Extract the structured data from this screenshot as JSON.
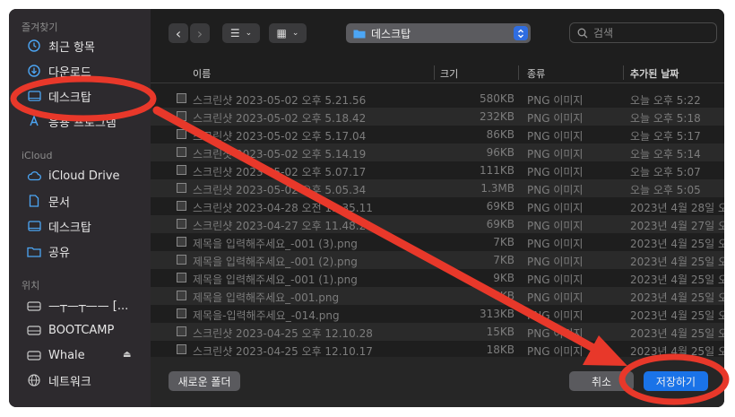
{
  "sidebar": {
    "favorites_title": "즐겨찾기",
    "favorites": [
      {
        "label": "최근 항목",
        "icon": "clock-icon"
      },
      {
        "label": "다운로드",
        "icon": "download-icon"
      },
      {
        "label": "데스크탑",
        "icon": "desktop-icon"
      },
      {
        "label": "응용 프로그램",
        "icon": "apps-icon"
      }
    ],
    "icloud_title": "iCloud",
    "icloud": [
      {
        "label": "iCloud Drive",
        "icon": "cloud-icon"
      },
      {
        "label": "문서",
        "icon": "document-icon"
      },
      {
        "label": "데스크탑",
        "icon": "desktop-icon"
      },
      {
        "label": "공유",
        "icon": "shared-folder-icon"
      }
    ],
    "locations_title": "위치",
    "locations": [
      {
        "label": "—┬—┬—— [...",
        "icon": "drive-icon"
      },
      {
        "label": "BOOTCAMP",
        "icon": "drive-icon"
      },
      {
        "label": "Whale",
        "icon": "drive-icon",
        "eject": "⏏"
      },
      {
        "label": "네트워크",
        "icon": "globe-icon"
      }
    ]
  },
  "toolbar": {
    "back": "‹",
    "forward": "›",
    "list_view": "☰",
    "grid_view": "▦",
    "location": "데스크탑",
    "search_placeholder": "검색"
  },
  "table": {
    "headers": {
      "name": "이름",
      "size": "크기",
      "kind": "종류",
      "date": "추가된 날짜"
    },
    "rows": [
      {
        "name": "스크린샷 2023-05-02 오후 5.21.56",
        "size": "580KB",
        "kind": "PNG 이미지",
        "date": "오늘 오후 5:22"
      },
      {
        "name": "스크린샷 2023-05-02 오후 5.18.42",
        "size": "232KB",
        "kind": "PNG 이미지",
        "date": "오늘 오후 5:18"
      },
      {
        "name": "스크린샷 2023-05-02 오후 5.17.04",
        "size": "86KB",
        "kind": "PNG 이미지",
        "date": "오늘 오후 5:17"
      },
      {
        "name": "스크린샷 2023-05-02 오후 5.14.19",
        "size": "96KB",
        "kind": "PNG 이미지",
        "date": "오늘 오후 5:14"
      },
      {
        "name": "스크린샷 2023-05-02 오후 5.07.17",
        "size": "111KB",
        "kind": "PNG 이미지",
        "date": "오늘 오후 5:07"
      },
      {
        "name": "스크린샷 2023-05-02 오후 5.05.34",
        "size": "1.3MB",
        "kind": "PNG 이미지",
        "date": "오늘 오후 5:05"
      },
      {
        "name": "스크린샷 2023-04-28 오전 11.35.11",
        "size": "69KB",
        "kind": "PNG 이미지",
        "date": "2023년 4월 28일 오"
      },
      {
        "name": "스크린샷 2023-04-27 오후 11.48.21",
        "size": "69KB",
        "kind": "PNG 이미지",
        "date": "2023년 4월 27일 오"
      },
      {
        "name": "제목을 입력해주세요_-001 (3).png",
        "size": "7KB",
        "kind": "PNG 이미지",
        "date": "2023년 4월 25일 오"
      },
      {
        "name": "제목을 입력해주세요_-001 (2).png",
        "size": "7KB",
        "kind": "PNG 이미지",
        "date": "2023년 4월 25일 오"
      },
      {
        "name": "제목을 입력해주세요_-001 (1).png",
        "size": "9KB",
        "kind": "PNG 이미지",
        "date": "2023년 4월 25일 오"
      },
      {
        "name": "제목을 입력해주세요_-001.png",
        "size": "6KB",
        "kind": "PNG 이미지",
        "date": "2023년 4월 25일 오"
      },
      {
        "name": "제목을-입력해주세요_-014.png",
        "size": "313KB",
        "kind": "PNG 이미지",
        "date": "2023년 4월 25일 오"
      },
      {
        "name": "스크린샷 2023-04-25 오후 12.10.28",
        "size": "15KB",
        "kind": "PNG 이미지",
        "date": "2023년 4월 25일 오"
      },
      {
        "name": "스크린샷 2023-04-25 오후 12.10.17",
        "size": "18KB",
        "kind": "PNG 이미지",
        "date": "2023년 4월 25일 오"
      }
    ]
  },
  "bottom": {
    "new_folder": "새로운 폴더",
    "cancel": "취소",
    "save": "저장하기"
  },
  "colors": {
    "annotation_red": "#e8382a",
    "save_blue": "#1a73e8",
    "folder_blue": "#4ca6f5"
  }
}
